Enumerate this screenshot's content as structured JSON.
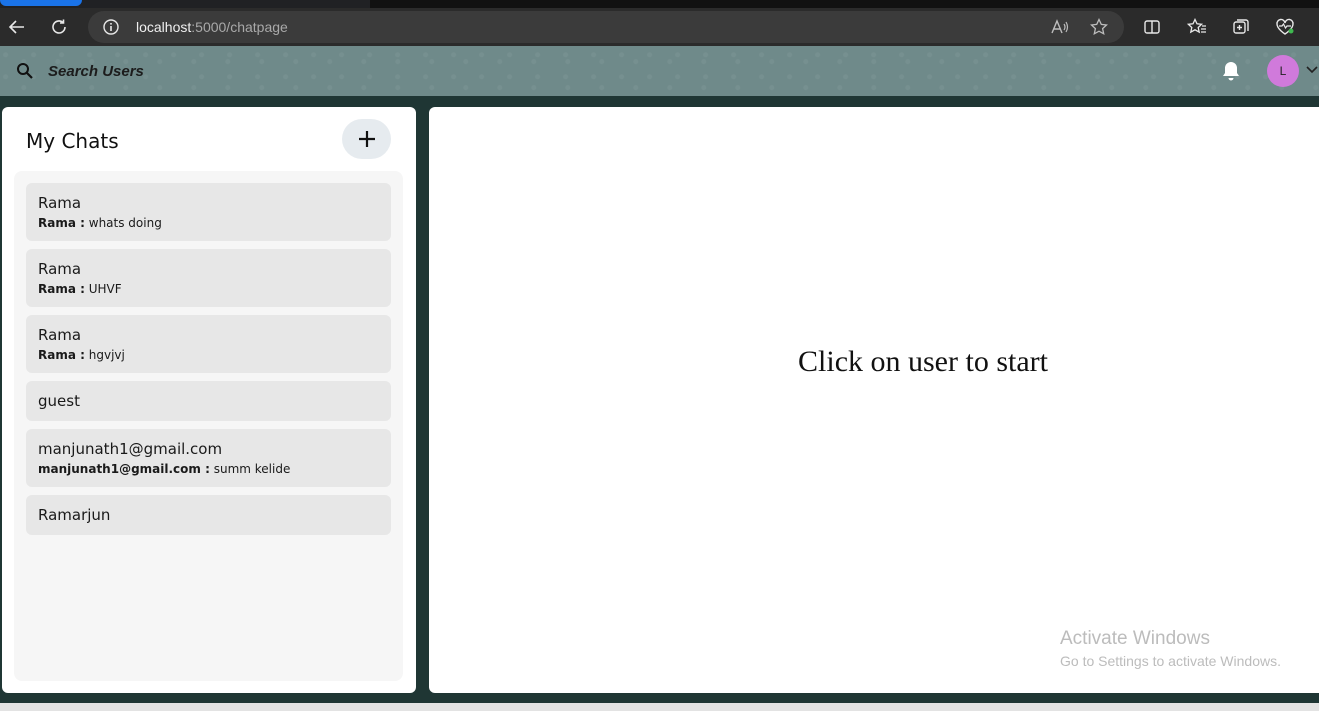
{
  "browser": {
    "url_host": "localhost",
    "url_path": ":5000/chatpage",
    "icons": [
      "back-arrow-icon",
      "refresh-icon",
      "info-icon",
      "read-aloud-icon",
      "favorite-star-icon",
      "split-screen-icon",
      "favorites-icon",
      "collections-icon",
      "browser-essentials-icon"
    ]
  },
  "header": {
    "search_label": "Search Users",
    "avatar_initial": "L",
    "avatar_color": "#d07adb"
  },
  "sidebar": {
    "title": "My Chats",
    "chats": [
      {
        "name": "Rama",
        "sender": "Rama :",
        "message": "whats doing"
      },
      {
        "name": "Rama",
        "sender": "Rama :",
        "message": "UHVF"
      },
      {
        "name": "Rama",
        "sender": "Rama :",
        "message": "hgvjvj"
      },
      {
        "name": "guest"
      },
      {
        "name": "manjunath1@gmail.com",
        "sender": "manjunath1@gmail.com :",
        "message": "summ kelide"
      },
      {
        "name": "Ramarjun"
      }
    ]
  },
  "chatbox": {
    "empty_message": "Click on user to start"
  },
  "watermark": {
    "line1": "Activate Windows",
    "line2": "Go to Settings to activate Windows."
  }
}
